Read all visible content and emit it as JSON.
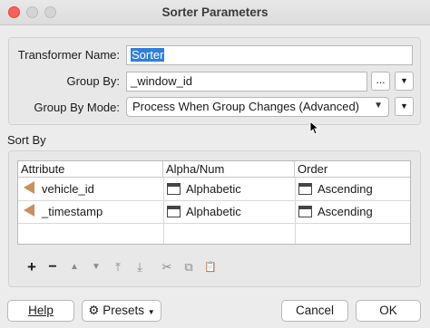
{
  "window": {
    "title": "Sorter Parameters"
  },
  "form": {
    "transformer_name_label": "Transformer Name:",
    "transformer_name_value": "Sorter",
    "group_by_label": "Group By:",
    "group_by_value": "_window_id",
    "group_by_ellipsis": "...",
    "group_by_mode_label": "Group By Mode:",
    "group_by_mode_value": "Process When Group Changes (Advanced)"
  },
  "sort_by": {
    "title": "Sort By",
    "columns": [
      "Attribute",
      "Alpha/Num",
      "Order"
    ],
    "rows": [
      {
        "attribute": "vehicle_id",
        "alpha_num": "Alphabetic",
        "order": "Ascending"
      },
      {
        "attribute": "_timestamp",
        "alpha_num": "Alphabetic",
        "order": "Ascending"
      }
    ]
  },
  "toolbar": {
    "add": "+",
    "remove": "−",
    "move_up": "▲",
    "move_down": "▼",
    "move_top": "⤒",
    "move_bottom": "⤓",
    "cut": "✂",
    "copy": "⧉",
    "paste": "📋"
  },
  "buttons": {
    "help": "Help",
    "presets": "Presets",
    "cancel": "Cancel",
    "ok": "OK"
  },
  "icons": {
    "close": "close-icon",
    "minimize": "minimize-icon",
    "maximize": "maximize-icon",
    "attribute": "attribute-arrow-icon",
    "checkbox": "column-checkbox-icon",
    "presets": "gear-icon",
    "dropdown": "chevron-down-icon"
  },
  "colors": {
    "selection": "#2f7fde",
    "close": "#fe5f57",
    "attribute_arrow": "#c9905e"
  }
}
